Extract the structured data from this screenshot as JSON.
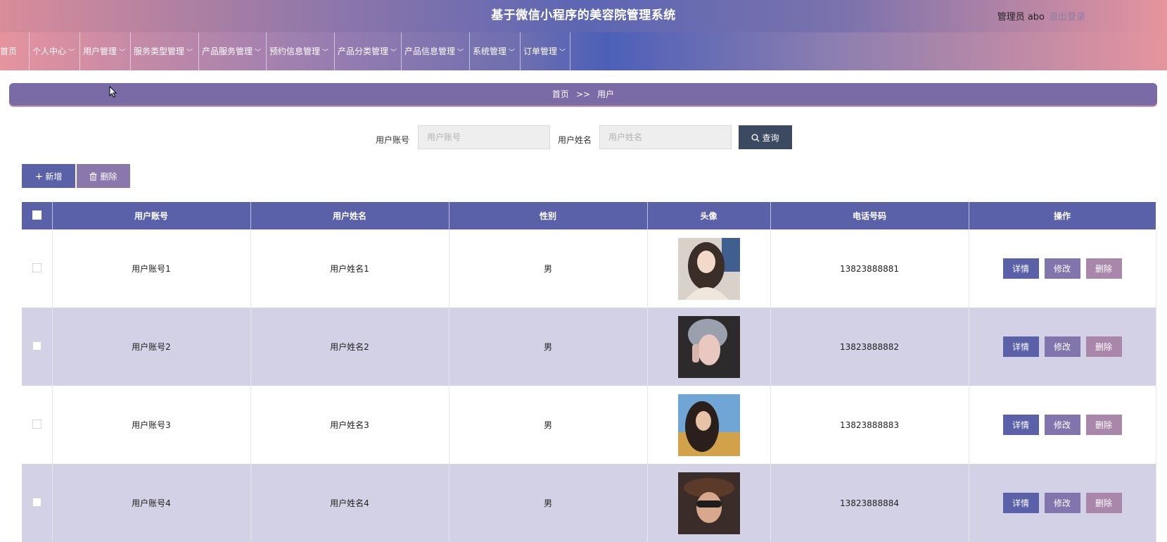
{
  "header": {
    "title": "基于微信小程序的美容院管理系统",
    "user_label": "管理员 abo",
    "logout_label": "退出登录"
  },
  "nav": {
    "items": [
      {
        "label": "首页",
        "has_dropdown": false
      },
      {
        "label": "个人中心",
        "has_dropdown": true
      },
      {
        "label": "用户管理",
        "has_dropdown": true
      },
      {
        "label": "服务类型管理",
        "has_dropdown": true
      },
      {
        "label": "产品服务管理",
        "has_dropdown": true
      },
      {
        "label": "预约信息管理",
        "has_dropdown": true
      },
      {
        "label": "产品分类管理",
        "has_dropdown": true
      },
      {
        "label": "产品信息管理",
        "has_dropdown": true
      },
      {
        "label": "系统管理",
        "has_dropdown": true
      },
      {
        "label": "订单管理",
        "has_dropdown": true
      }
    ]
  },
  "breadcrumb": {
    "home": "首页",
    "separator": ">>",
    "current": "用户"
  },
  "search": {
    "account_label": "用户账号",
    "account_placeholder": "用户账号",
    "account_value": "",
    "name_label": "用户姓名",
    "name_placeholder": "用户姓名",
    "name_value": "",
    "button_label": "查询"
  },
  "actions": {
    "add_label": "新增",
    "delete_label": "删除"
  },
  "table": {
    "headers": [
      "用户账号",
      "用户姓名",
      "性别",
      "头像",
      "电话号码",
      "操作"
    ],
    "row_actions": {
      "detail": "详情",
      "edit": "修改",
      "delete": "删除"
    },
    "rows": [
      {
        "account": "用户账号1",
        "name": "用户姓名1",
        "gender": "男",
        "phone": "13823888881"
      },
      {
        "account": "用户账号2",
        "name": "用户姓名2",
        "gender": "男",
        "phone": "13823888882"
      },
      {
        "account": "用户账号3",
        "name": "用户姓名3",
        "gender": "男",
        "phone": "13823888883"
      },
      {
        "account": "用户账号4",
        "name": "用户姓名4",
        "gender": "男",
        "phone": "13823888884"
      }
    ]
  },
  "colors": {
    "primary": "#5b61a8",
    "secondary": "#8275ae",
    "accent": "#a887aa",
    "search_button": "#3b4a60",
    "row_alt": "#d3d1e6"
  }
}
